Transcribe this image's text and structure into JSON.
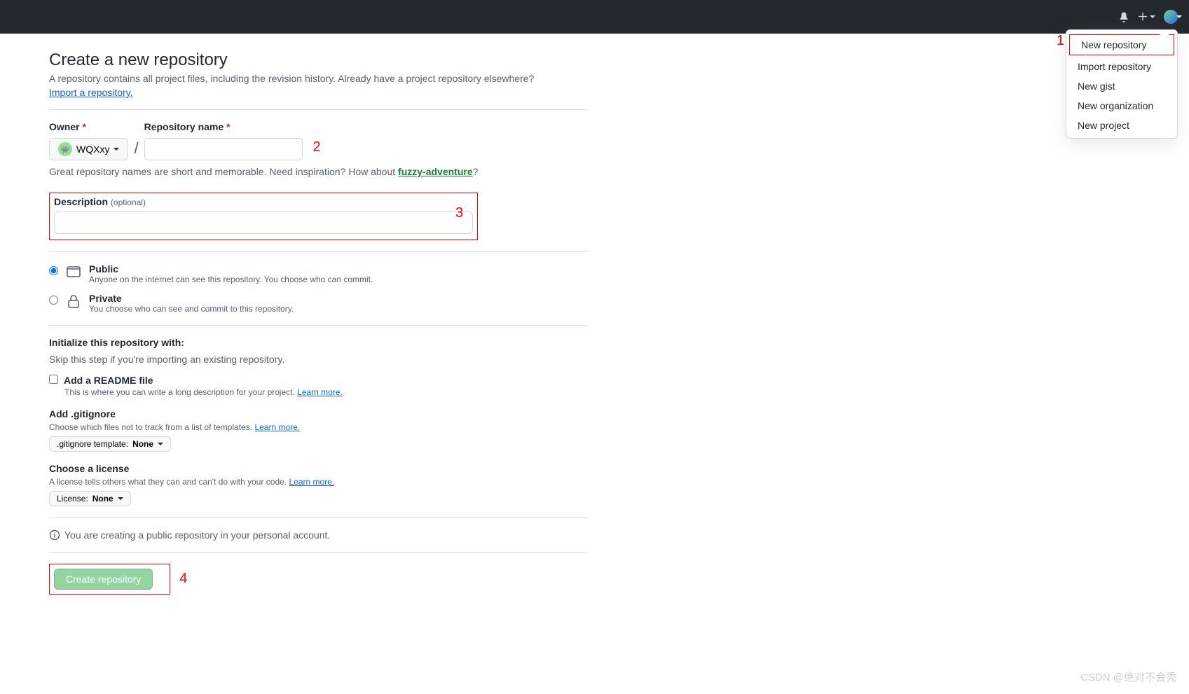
{
  "topbar": {
    "dropdown_items": [
      "New repository",
      "Import repository",
      "New gist",
      "New organization",
      "New project"
    ]
  },
  "annotations": {
    "a1": "1",
    "a2": "2",
    "a3": "3",
    "a4": "4"
  },
  "page": {
    "title": "Create a new repository",
    "subhead": "A repository contains all project files, including the revision history. Already have a project repository elsewhere?",
    "import_link": "Import a repository."
  },
  "owner": {
    "label": "Owner",
    "name": "WQXxy"
  },
  "repo_name": {
    "label": "Repository name",
    "value": ""
  },
  "name_hint": {
    "pre": "Great repository names are short and memorable. Need inspiration? How about ",
    "suggestion": "fuzzy-adventure",
    "post": "?"
  },
  "description": {
    "label": "Description",
    "optional": "(optional)",
    "value": ""
  },
  "visibility": {
    "public": {
      "title": "Public",
      "sub": "Anyone on the internet can see this repository. You choose who can commit."
    },
    "private": {
      "title": "Private",
      "sub": "You choose who can see and commit to this repository."
    }
  },
  "init": {
    "header": "Initialize this repository with:",
    "skip": "Skip this step if you're importing an existing repository.",
    "readme": {
      "title": "Add a README file",
      "sub_pre": "This is where you can write a long description for your project. ",
      "learn": "Learn more."
    },
    "gitignore": {
      "title": "Add .gitignore",
      "sub_pre": "Choose which files not to track from a list of templates. ",
      "learn": "Learn more.",
      "btn_pre": ".gitignore template: ",
      "btn_val": "None"
    },
    "license": {
      "title": "Choose a license",
      "sub_pre": "A license tells others what they can and can't do with your code. ",
      "learn": "Learn more.",
      "btn_pre": "License: ",
      "btn_val": "None"
    }
  },
  "info_line": "You are creating a public repository in your personal account.",
  "create_button": "Create repository",
  "watermark": "CSDN @绝对不会秃"
}
